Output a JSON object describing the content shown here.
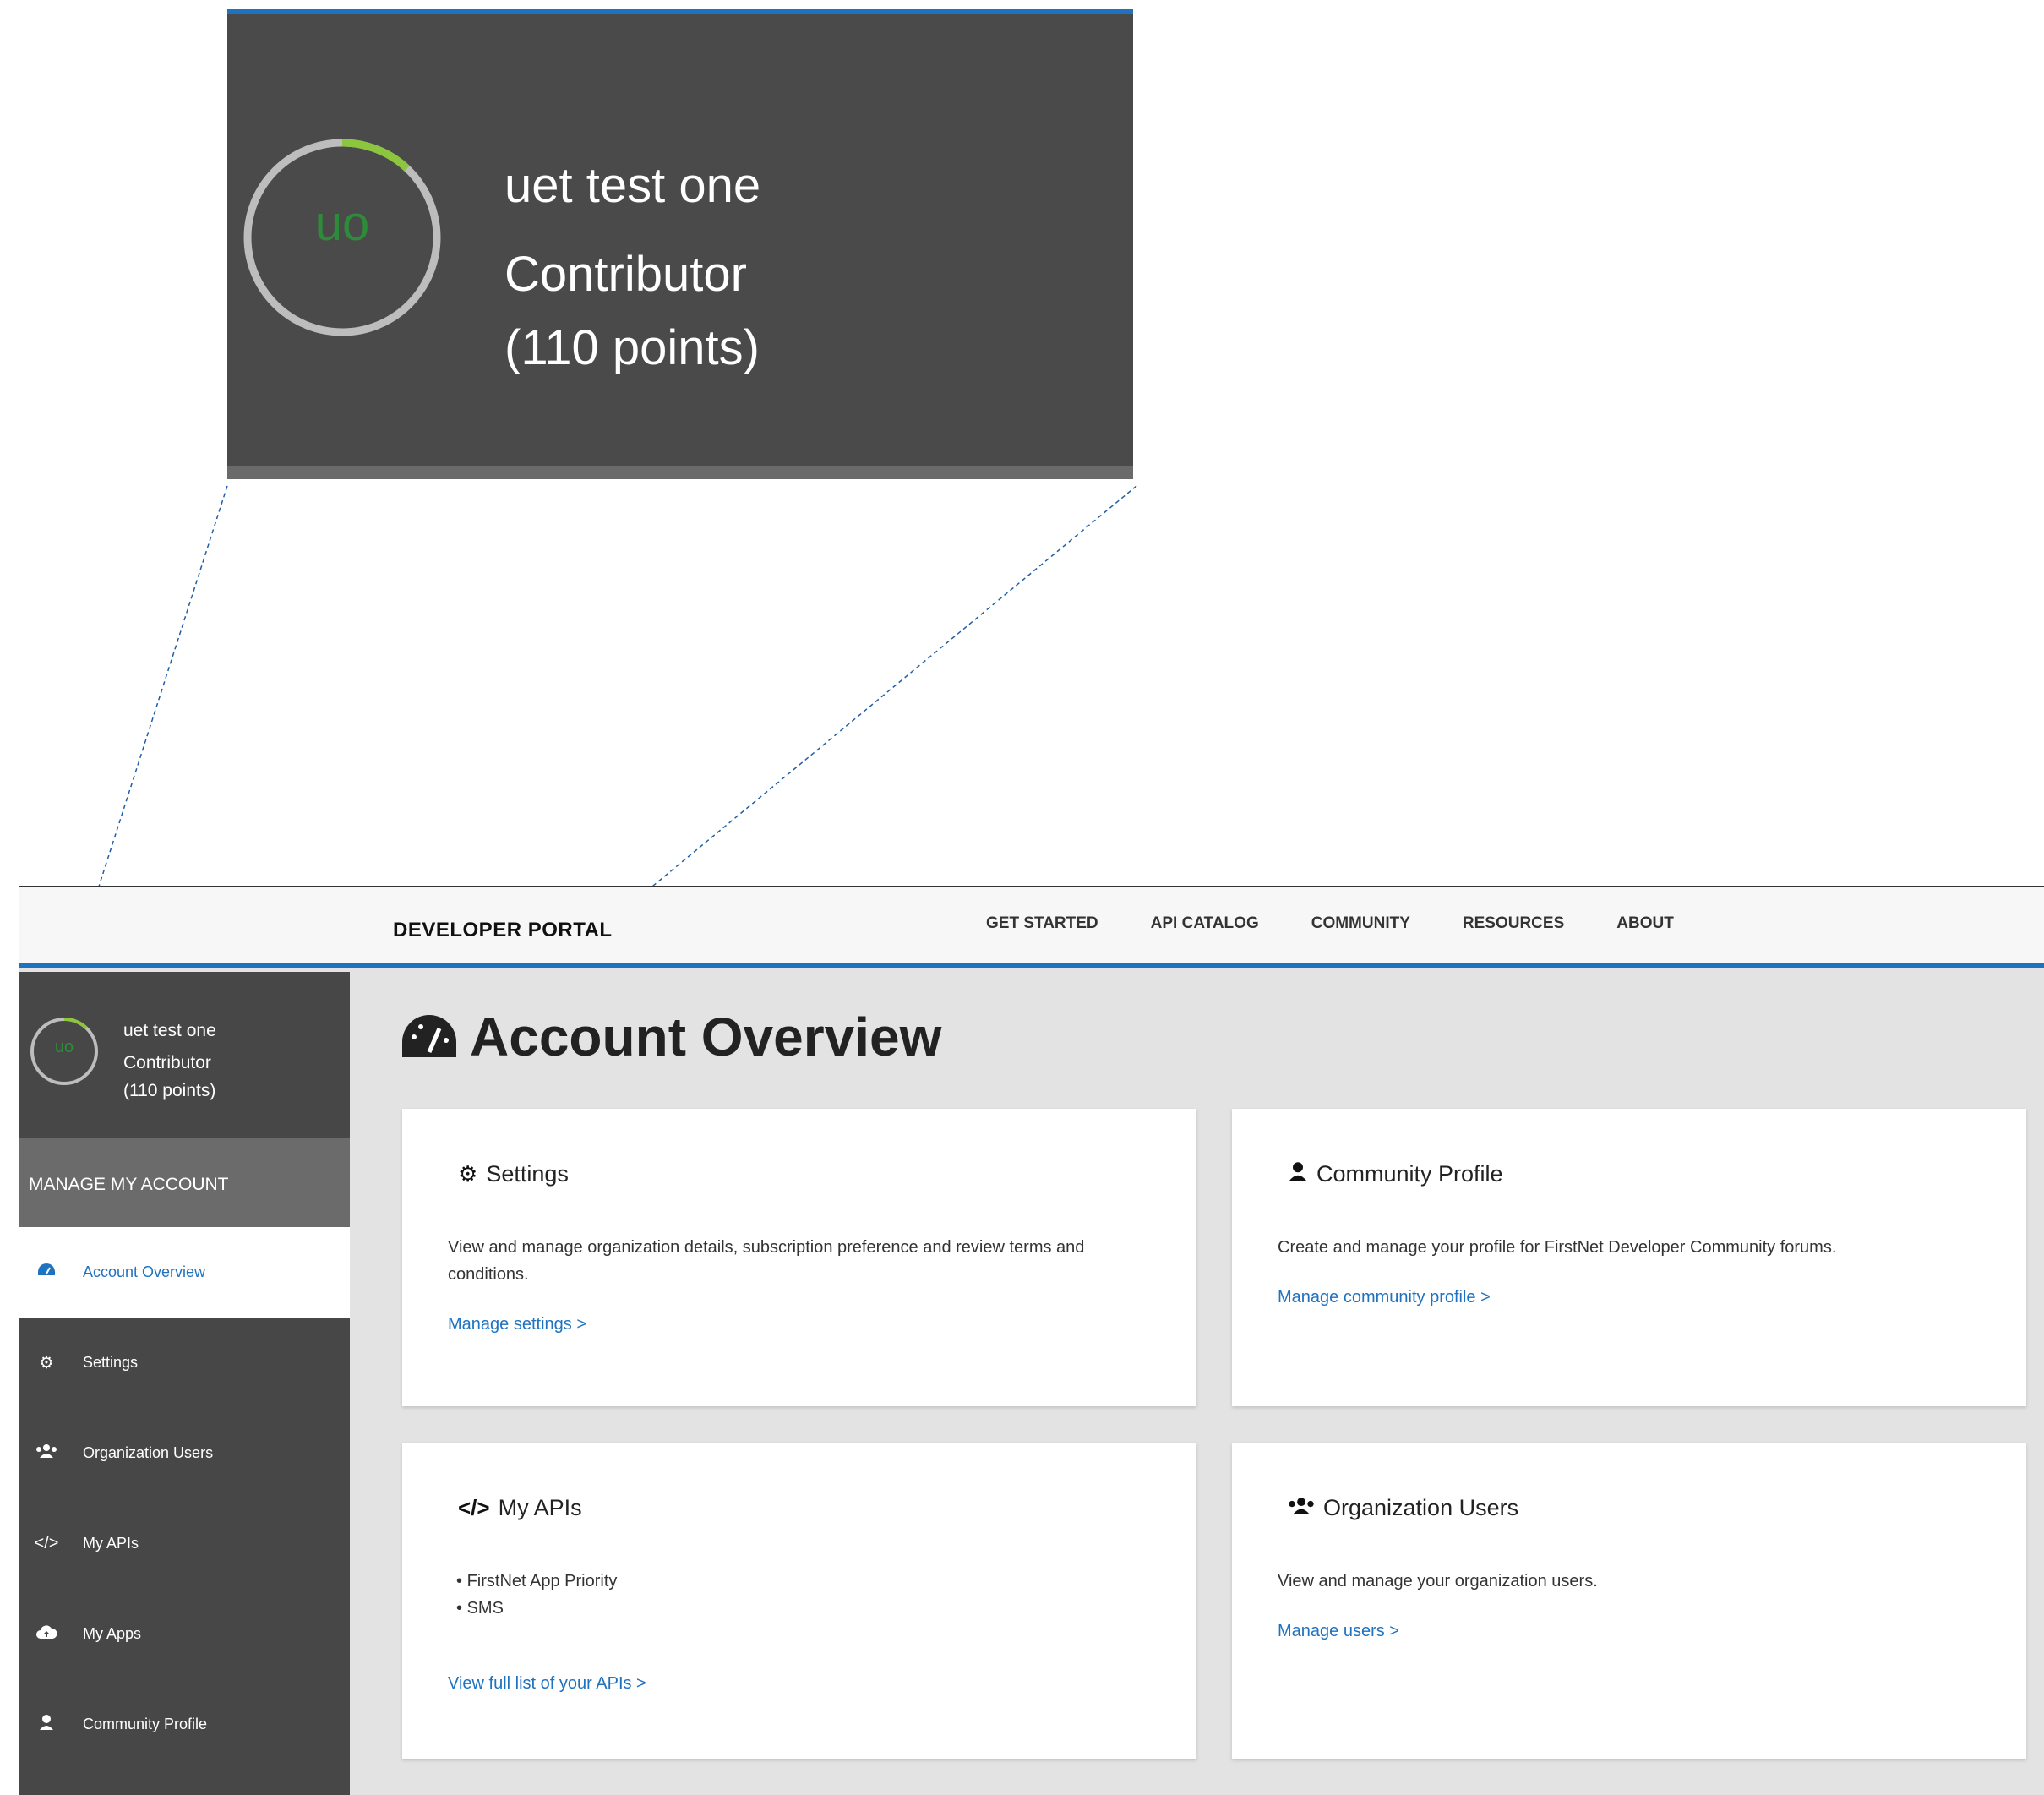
{
  "zoom": {
    "initials": "uo",
    "name": "uet test one",
    "role": "Contributor",
    "points": "(110 points)",
    "progress": 0.12
  },
  "topnav": {
    "brand": "DEVELOPER PORTAL",
    "links": [
      "GET STARTED",
      "API CATALOG",
      "COMMUNITY",
      "RESOURCES",
      "ABOUT"
    ]
  },
  "sidebar": {
    "profile": {
      "initials": "uo",
      "name": "uet test one",
      "role": "Contributor",
      "points": "(110 points)"
    },
    "section_title": "MANAGE MY ACCOUNT",
    "items": [
      {
        "label": "Account Overview",
        "icon": "dashboard-icon"
      },
      {
        "label": "Settings",
        "icon": "gear-icon"
      },
      {
        "label": "Organization Users",
        "icon": "users-icon"
      },
      {
        "label": "My APIs",
        "icon": "code-icon"
      },
      {
        "label": "My Apps",
        "icon": "cloud-upload-icon"
      },
      {
        "label": "Community Profile",
        "icon": "user-icon"
      }
    ]
  },
  "main": {
    "title": "Account Overview",
    "cards": {
      "settings": {
        "title": "Settings",
        "text": "View and manage organization details, subscription preference and review terms and conditions.",
        "link": "Manage settings >"
      },
      "community": {
        "title": "Community Profile",
        "text": "Create and manage your profile for FirstNet Developer Community forums.",
        "link": "Manage community profile >"
      },
      "apis": {
        "title": "My APIs",
        "items": [
          "FirstNet App Priority",
          "SMS"
        ],
        "link": "View full list of your APIs >"
      },
      "orgusers": {
        "title": "Organization Users",
        "text": "View and manage your organization users.",
        "link": "Manage users >"
      }
    }
  },
  "colors": {
    "accent": "#1f72c0",
    "sidebar": "#474747",
    "progress": "#8cc63f",
    "initials": "#2e8b3a"
  }
}
